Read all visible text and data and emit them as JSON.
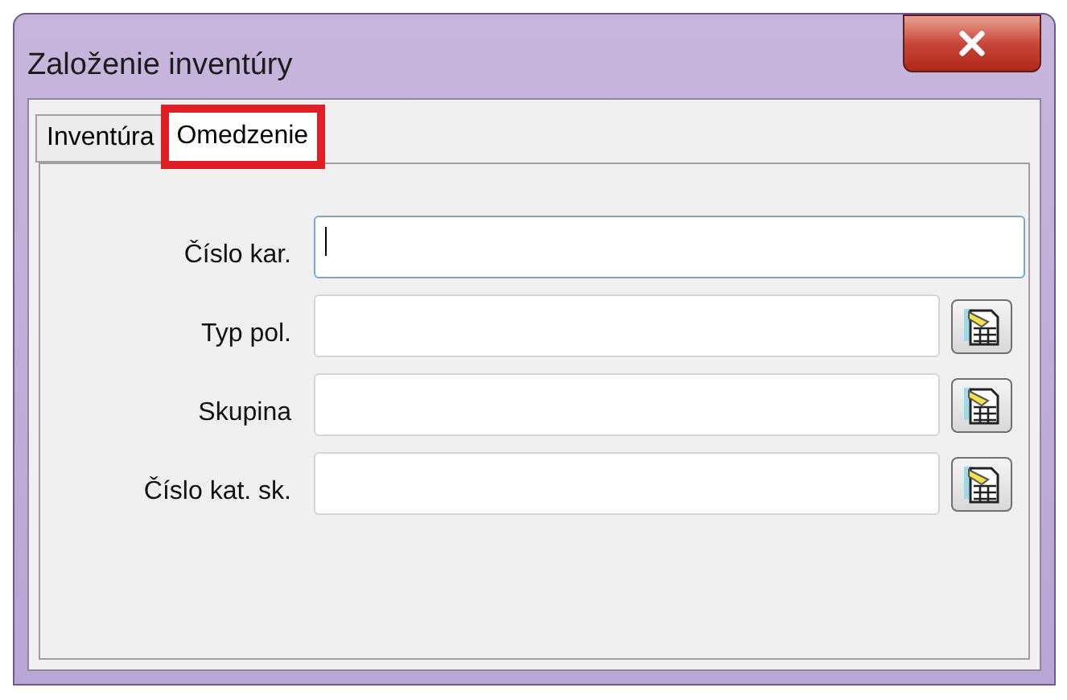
{
  "window": {
    "title": "Založenie inventúry"
  },
  "tabs": [
    {
      "label": "Inventúra",
      "selected": false,
      "highlighted": false
    },
    {
      "label": "Omedzenie",
      "selected": true,
      "highlighted": true
    }
  ],
  "fields": [
    {
      "label": "Číslo kar.",
      "focused": true,
      "lookup": false
    },
    {
      "label": "Typ pol.",
      "focused": false,
      "lookup": true
    },
    {
      "label": "Skupina",
      "focused": false,
      "lookup": true
    },
    {
      "label": "Číslo kat. sk.",
      "focused": false,
      "lookup": true
    }
  ]
}
